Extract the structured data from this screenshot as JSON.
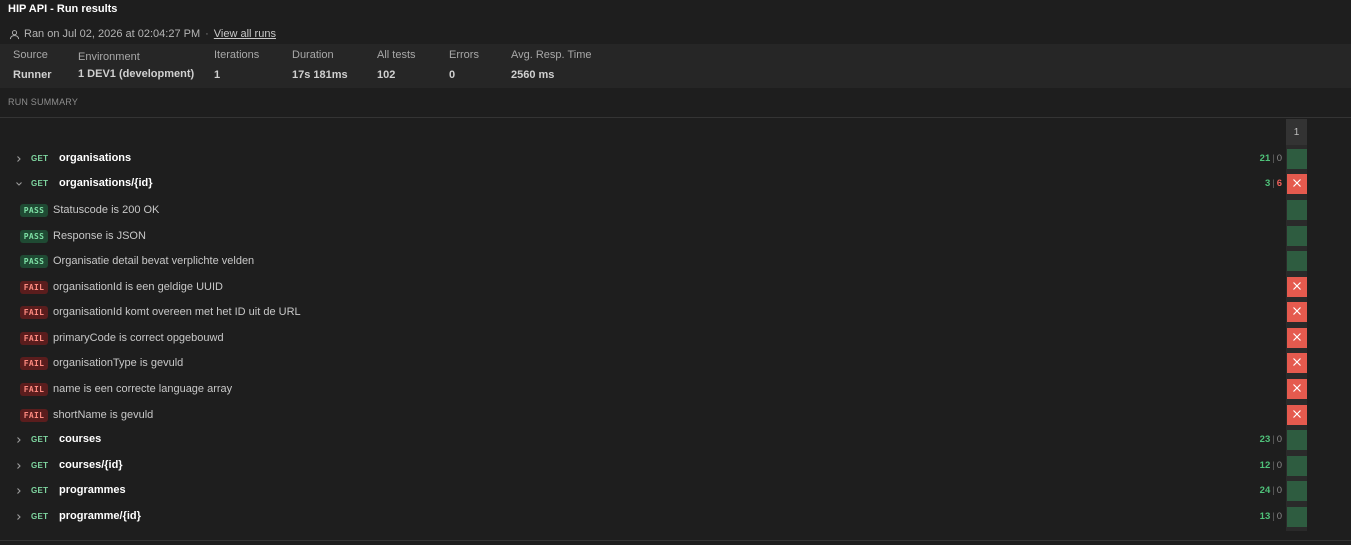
{
  "header": {
    "title": "HIP API - Run results",
    "ran_on": "Ran on Jul 02, 2026 at 02:04:27 PM",
    "separator": "·",
    "view_all_runs": "View all runs"
  },
  "stats": [
    {
      "label": "Source",
      "value": "Runner"
    },
    {
      "label": "Environment",
      "value": "1 DEV1 (development)"
    },
    {
      "label": "Iterations",
      "value": "1"
    },
    {
      "label": "Duration",
      "value": "17s 181ms"
    },
    {
      "label": "All tests",
      "value": "102"
    },
    {
      "label": "Errors",
      "value": "0"
    },
    {
      "label": "Avg. Resp. Time",
      "value": "2560 ms"
    }
  ],
  "summary_label": "RUN SUMMARY",
  "iteration_header": "1",
  "colors": {
    "pass_green": "#4fc27a",
    "fail_red": "#e55a4e",
    "cell_green": "#2e5c40",
    "background": "#1e1e1e"
  },
  "requests": [
    {
      "method": "GET",
      "name": "organisations",
      "passed": "21",
      "failed": "0",
      "expanded": false,
      "status": "pass"
    },
    {
      "method": "GET",
      "name": "organisations/{id}",
      "passed": "3",
      "failed": "6",
      "expanded": true,
      "status": "fail",
      "tests": [
        {
          "result": "PASS",
          "name": "Statuscode is 200 OK"
        },
        {
          "result": "PASS",
          "name": "Response is JSON"
        },
        {
          "result": "PASS",
          "name": "Organisatie detail bevat verplichte velden"
        },
        {
          "result": "FAIL",
          "name": "organisationId is een geldige UUID"
        },
        {
          "result": "FAIL",
          "name": "organisationId komt overeen met het ID uit de URL"
        },
        {
          "result": "FAIL",
          "name": "primaryCode is correct opgebouwd"
        },
        {
          "result": "FAIL",
          "name": "organisationType is gevuld"
        },
        {
          "result": "FAIL",
          "name": "name is een correcte language array"
        },
        {
          "result": "FAIL",
          "name": "shortName is gevuld"
        }
      ]
    },
    {
      "method": "GET",
      "name": "courses",
      "passed": "23",
      "failed": "0",
      "expanded": false,
      "status": "pass"
    },
    {
      "method": "GET",
      "name": "courses/{id}",
      "passed": "12",
      "failed": "0",
      "expanded": false,
      "status": "pass"
    },
    {
      "method": "GET",
      "name": "programmes",
      "passed": "24",
      "failed": "0",
      "expanded": false,
      "status": "pass"
    },
    {
      "method": "GET",
      "name": "programme/{id}",
      "passed": "13",
      "failed": "0",
      "expanded": false,
      "status": "pass"
    }
  ]
}
